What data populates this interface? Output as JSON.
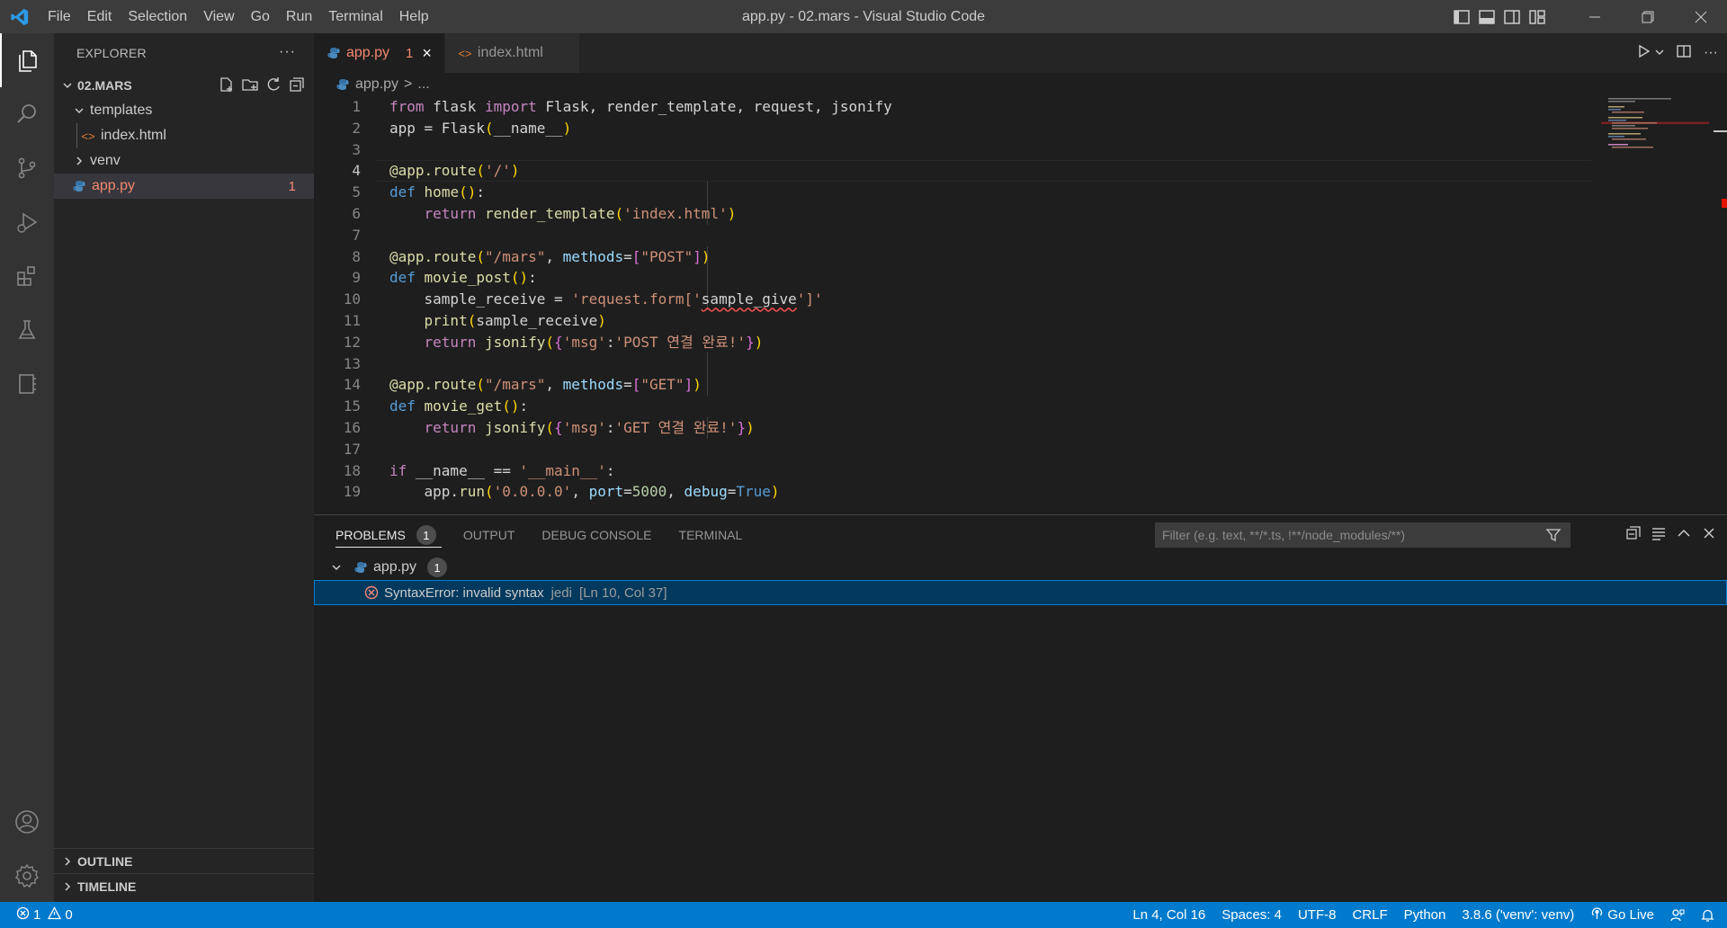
{
  "titlebar": {
    "menu": [
      "File",
      "Edit",
      "Selection",
      "View",
      "Go",
      "Run",
      "Terminal",
      "Help"
    ],
    "title": "app.py - 02.mars - Visual Studio Code"
  },
  "explorer": {
    "header": "EXPLORER",
    "more": "···",
    "folder": "02.MARS",
    "tree": [
      {
        "label": "templates",
        "type": "folder-open"
      },
      {
        "label": "index.html",
        "type": "html"
      },
      {
        "label": "venv",
        "type": "folder-closed"
      },
      {
        "label": "app.py",
        "type": "python",
        "errors": "1"
      }
    ],
    "outline": "OUTLINE",
    "timeline": "TIMELINE"
  },
  "tabs": [
    {
      "label": "app.py",
      "errors": "1",
      "close": "×"
    },
    {
      "label": "index.html"
    }
  ],
  "breadcrumb": {
    "file": "app.py",
    "sep": ">",
    "rest": "..."
  },
  "editor": {
    "line_numbers": [
      "1",
      "2",
      "3",
      "4",
      "5",
      "6",
      "7",
      "8",
      "9",
      "10",
      "11",
      "12",
      "13",
      "14",
      "15",
      "16",
      "17",
      "18",
      "19"
    ],
    "current_line": 4
  },
  "panel": {
    "tabs": [
      {
        "label": "PROBLEMS",
        "count": "1"
      },
      {
        "label": "OUTPUT"
      },
      {
        "label": "DEBUG CONSOLE"
      },
      {
        "label": "TERMINAL"
      }
    ],
    "filter_placeholder": "Filter (e.g. text, **/*.ts, !**/node_modules/**)",
    "file": "app.py",
    "file_count": "1",
    "problem": {
      "message": "SyntaxError: invalid syntax",
      "source": "jedi",
      "location": "[Ln 10, Col 37]"
    }
  },
  "status": {
    "errors": "1",
    "warnings": "0",
    "position": "Ln 4, Col 16",
    "spaces": "Spaces: 4",
    "encoding": "UTF-8",
    "eol": "CRLF",
    "language": "Python",
    "interpreter": "3.8.6 ('venv': venv)",
    "golive": "Go Live"
  },
  "colors": {
    "statusbar": "#007acc",
    "error": "#f48771",
    "titlebar": "#3c3c3c"
  }
}
